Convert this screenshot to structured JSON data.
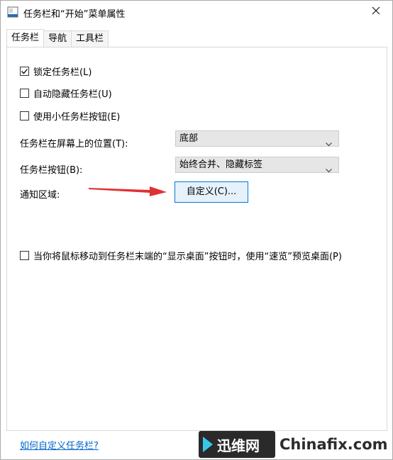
{
  "window": {
    "title": "任务栏和“开始”菜单属性"
  },
  "tabs": [
    {
      "label": "任务栏",
      "active": true
    },
    {
      "label": "导航",
      "active": false
    },
    {
      "label": "工具栏",
      "active": false
    }
  ],
  "options": {
    "lock_taskbar": {
      "label": "锁定任务栏(L)",
      "checked": true
    },
    "auto_hide": {
      "label": "自动隐藏任务栏(U)",
      "checked": false
    },
    "small_buttons": {
      "label": "使用小任务栏按钮(E)",
      "checked": false
    },
    "peek": {
      "label": "当你将鼠标移动到任务栏末端的“显示桌面”按钮时，使用“速览”预览桌面(P)",
      "checked": false
    }
  },
  "location": {
    "label": "任务栏在屏幕上的位置(T):",
    "value": "底部"
  },
  "buttons_setting": {
    "label": "任务栏按钮(B):",
    "value": "始终合并、隐藏标签"
  },
  "notification": {
    "label": "通知区域:",
    "customize_label": "自定义(C)..."
  },
  "help_link": "如何自定义任务栏?",
  "watermark": {
    "brand": "迅维网",
    "site": "Chinafix.com"
  },
  "colors": {
    "accent": "#0078d7",
    "button_bg": "#e5f1fb",
    "link": "#0066cc",
    "arrow": "#e03131",
    "logo_mark": "#37c8e8"
  }
}
